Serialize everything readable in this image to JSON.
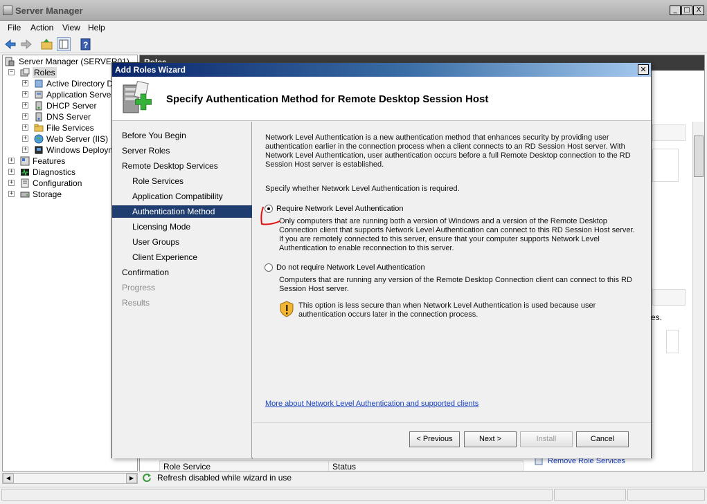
{
  "window": {
    "title": "Server Manager",
    "buttons": [
      "_",
      "□",
      "X"
    ]
  },
  "menu": [
    "File",
    "Action",
    "View",
    "Help"
  ],
  "tree": {
    "root": "Server Manager (SERVER01)",
    "roles": "Roles",
    "role_items": [
      "Active Directory Dor",
      "Application Server",
      "DHCP Server",
      "DNS Server",
      "File Services",
      "Web Server (IIS)",
      "Windows Deploymer"
    ],
    "other_items": [
      "Features",
      "Diagnostics",
      "Configuration",
      "Storage"
    ]
  },
  "right_pane": {
    "header": "Roles",
    "partial_text": "es.",
    "table_headers": [
      "Role Service",
      "Status"
    ],
    "remove_link": "Remove Role Services"
  },
  "status_bar": {
    "text": "Refresh disabled while wizard in use"
  },
  "wizard": {
    "title": "Add Roles Wizard",
    "heading": "Specify Authentication Method for Remote Desktop Session Host",
    "nav": [
      {
        "label": "Before You Begin",
        "level": "top",
        "state": "normal"
      },
      {
        "label": "Server Roles",
        "level": "top",
        "state": "normal"
      },
      {
        "label": "Remote Desktop Services",
        "level": "top",
        "state": "normal"
      },
      {
        "label": "Role Services",
        "level": "sub",
        "state": "normal"
      },
      {
        "label": "Application Compatibility",
        "level": "sub",
        "state": "normal"
      },
      {
        "label": "Authentication Method",
        "level": "sub",
        "state": "selected"
      },
      {
        "label": "Licensing Mode",
        "level": "sub",
        "state": "normal"
      },
      {
        "label": "User Groups",
        "level": "sub",
        "state": "normal"
      },
      {
        "label": "Client Experience",
        "level": "sub",
        "state": "normal"
      },
      {
        "label": "Confirmation",
        "level": "top",
        "state": "normal"
      },
      {
        "label": "Progress",
        "level": "top",
        "state": "disabled"
      },
      {
        "label": "Results",
        "level": "top",
        "state": "disabled"
      }
    ],
    "intro_lines": [
      "Network Level Authentication is a new authentication method that enhances security by providing user",
      "authentication earlier in the connection process when a client connects to an RD Session Host server. With",
      "Network Level Authentication, user authentication occurs before a full Remote Desktop connection to the RD",
      "Session Host server is established."
    ],
    "prompt": "Specify whether Network Level Authentication is required.",
    "option_require": {
      "label": "Require Network Level Authentication",
      "selected": true,
      "desc_lines": [
        "Only computers that are running both a version of Windows and a version of the Remote Desktop",
        "Connection client that supports Network Level Authentication can connect to this RD Session Host server.",
        "If you are remotely connected to this server, ensure that your computer supports Network Level",
        "Authentication to enable reconnection to this server."
      ]
    },
    "option_not_require": {
      "label": "Do not require Network Level Authentication",
      "selected": false,
      "desc_lines": [
        "Computers that are running any version of the Remote Desktop Connection client can connect to this RD",
        "Session Host server."
      ],
      "warning_lines": [
        "This option is less secure than when Network Level Authentication is used because user",
        "authentication occurs later in the connection process."
      ]
    },
    "more_link": "More about Network Level Authentication and supported clients",
    "buttons": {
      "previous": "< Previous",
      "next": "Next >",
      "install": "Install",
      "cancel": "Cancel"
    }
  },
  "colors": {
    "wizard_title_start": "#0a246a",
    "nav_selected": "#1f3d6e",
    "link": "#1a3fbf",
    "annotation": "#e01010"
  }
}
